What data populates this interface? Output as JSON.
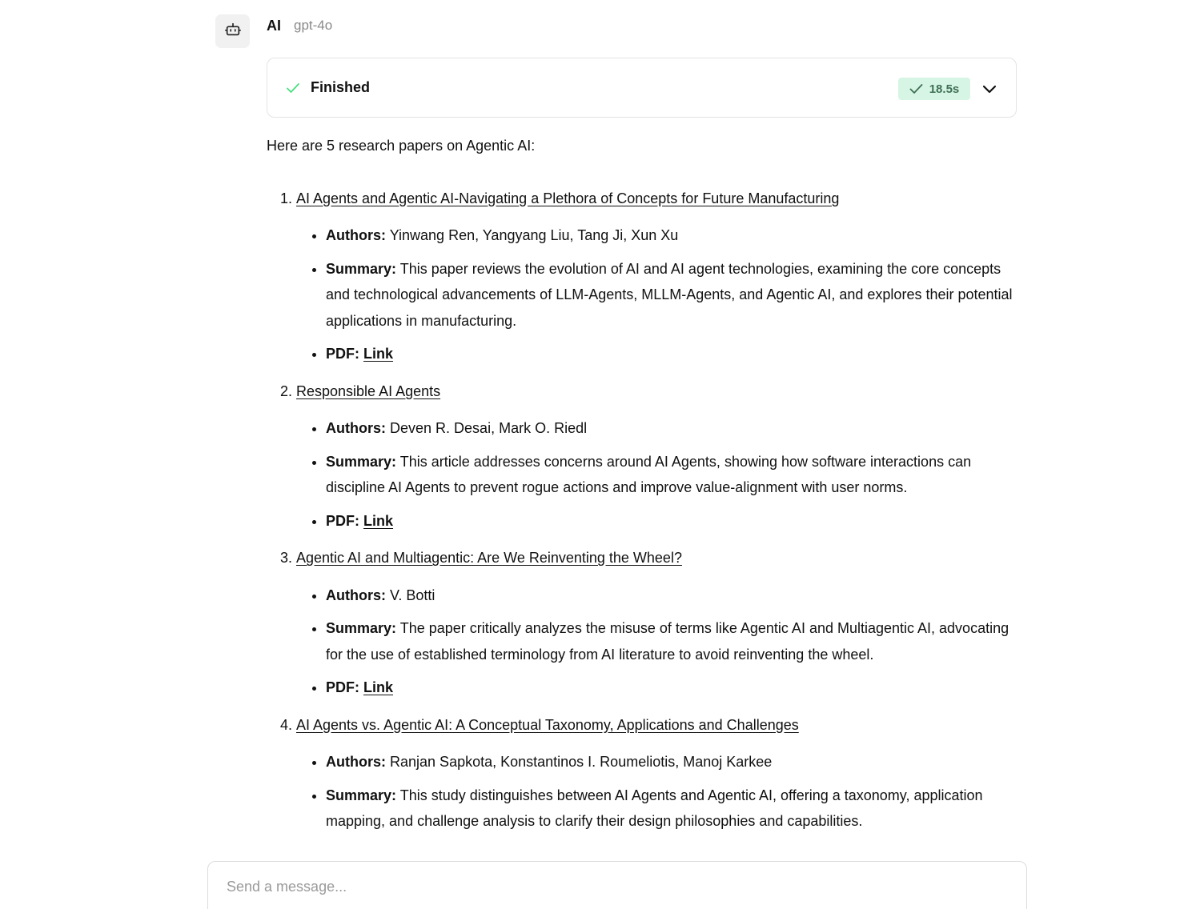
{
  "message": {
    "sender": "AI",
    "model": "gpt-4o",
    "avatar_icon": "bot-icon"
  },
  "status": {
    "label": "Finished",
    "duration": "18.5s",
    "check_color": "#4ade80",
    "badge_bg": "#d6f5e4",
    "badge_text_color": "#3f6f55"
  },
  "response": {
    "intro": "Here are 5 research papers on Agentic AI:",
    "labels": {
      "authors": "Authors:",
      "summary": "Summary:",
      "pdf": "PDF:",
      "link": "Link"
    },
    "papers": [
      {
        "title": "AI Agents and Agentic AI-Navigating a Plethora of Concepts for Future Manufacturing",
        "authors": "Yinwang Ren, Yangyang Liu, Tang Ji, Xun Xu",
        "summary": "This paper reviews the evolution of AI and AI agent technologies, examining the core concepts and technological advancements of LLM-Agents, MLLM-Agents, and Agentic AI, and explores their potential applications in manufacturing."
      },
      {
        "title": "Responsible AI Agents",
        "authors": "Deven R. Desai, Mark O. Riedl",
        "summary": "This article addresses concerns around AI Agents, showing how software interactions can discipline AI Agents to prevent rogue actions and improve value-alignment with user norms."
      },
      {
        "title": "Agentic AI and Multiagentic: Are We Reinventing the Wheel?",
        "authors": "V. Botti",
        "summary": "The paper critically analyzes the misuse of terms like Agentic AI and Multiagentic AI, advocating for the use of established terminology from AI literature to avoid reinventing the wheel."
      },
      {
        "title": "AI Agents vs. Agentic AI: A Conceptual Taxonomy, Applications and Challenges",
        "authors": "Ranjan Sapkota, Konstantinos I. Roumeliotis, Manoj Karkee",
        "summary": "This study distinguishes between AI Agents and Agentic AI, offering a taxonomy, application mapping, and challenge analysis to clarify their design philosophies and capabilities."
      }
    ]
  },
  "composer": {
    "placeholder": "Send a message..."
  }
}
